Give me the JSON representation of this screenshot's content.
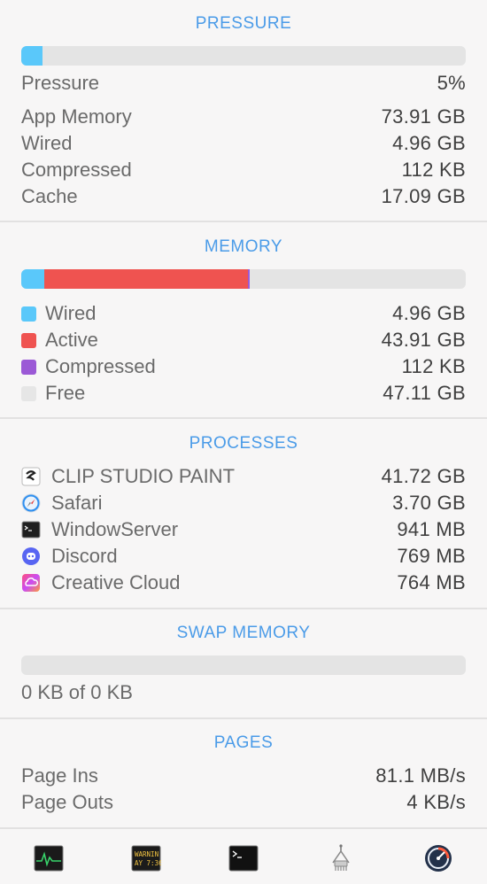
{
  "pressure": {
    "title": "PRESSURE",
    "bar_fraction": 0.05,
    "bar_color": "#5ac8fa",
    "rows": [
      {
        "label": "Pressure",
        "value": "5%"
      },
      {
        "label": "App Memory",
        "value": "73.91 GB"
      },
      {
        "label": "Wired",
        "value": "4.96 GB"
      },
      {
        "label": "Compressed",
        "value": "112 KB"
      },
      {
        "label": "Cache",
        "value": "17.09 GB"
      }
    ]
  },
  "memory": {
    "title": "MEMORY",
    "bar_segments": [
      {
        "name": "Wired",
        "fraction": 0.05,
        "color": "#5ac8fa"
      },
      {
        "name": "Active",
        "fraction": 0.46,
        "color": "#ef5350"
      },
      {
        "name": "Compressed",
        "fraction": 0.003,
        "color": "#9b59d6"
      }
    ],
    "rows": [
      {
        "label": "Wired",
        "value": "4.96 GB",
        "color": "#5ac8fa"
      },
      {
        "label": "Active",
        "value": "43.91 GB",
        "color": "#ef5350"
      },
      {
        "label": "Compressed",
        "value": "112 KB",
        "color": "#9b59d6"
      },
      {
        "label": "Free",
        "value": "47.11 GB",
        "color": "#e6e6e6"
      }
    ]
  },
  "processes": {
    "title": "PROCESSES",
    "rows": [
      {
        "label": "CLIP STUDIO PAINT",
        "value": "41.72 GB",
        "icon": "clip-studio-icon"
      },
      {
        "label": "Safari",
        "value": "3.70 GB",
        "icon": "safari-icon"
      },
      {
        "label": "WindowServer",
        "value": "941 MB",
        "icon": "terminal-icon"
      },
      {
        "label": "Discord",
        "value": "769 MB",
        "icon": "discord-icon"
      },
      {
        "label": "Creative Cloud",
        "value": "764 MB",
        "icon": "creative-cloud-icon"
      }
    ]
  },
  "swap": {
    "title": "SWAP MEMORY",
    "bar_fraction": 0,
    "summary": "0 KB of 0 KB"
  },
  "pages": {
    "title": "PAGES",
    "rows": [
      {
        "label": "Page Ins",
        "value": "81.1 MB/s"
      },
      {
        "label": "Page Outs",
        "value": "4 KB/s"
      }
    ]
  },
  "dock": {
    "items": [
      {
        "icon": "activity-monitor-icon"
      },
      {
        "icon": "console-icon",
        "text1": "WARNIN",
        "text2": "AY 7:36"
      },
      {
        "icon": "terminal-app-icon"
      },
      {
        "icon": "system-info-icon"
      },
      {
        "icon": "disk-utility-icon"
      }
    ]
  }
}
